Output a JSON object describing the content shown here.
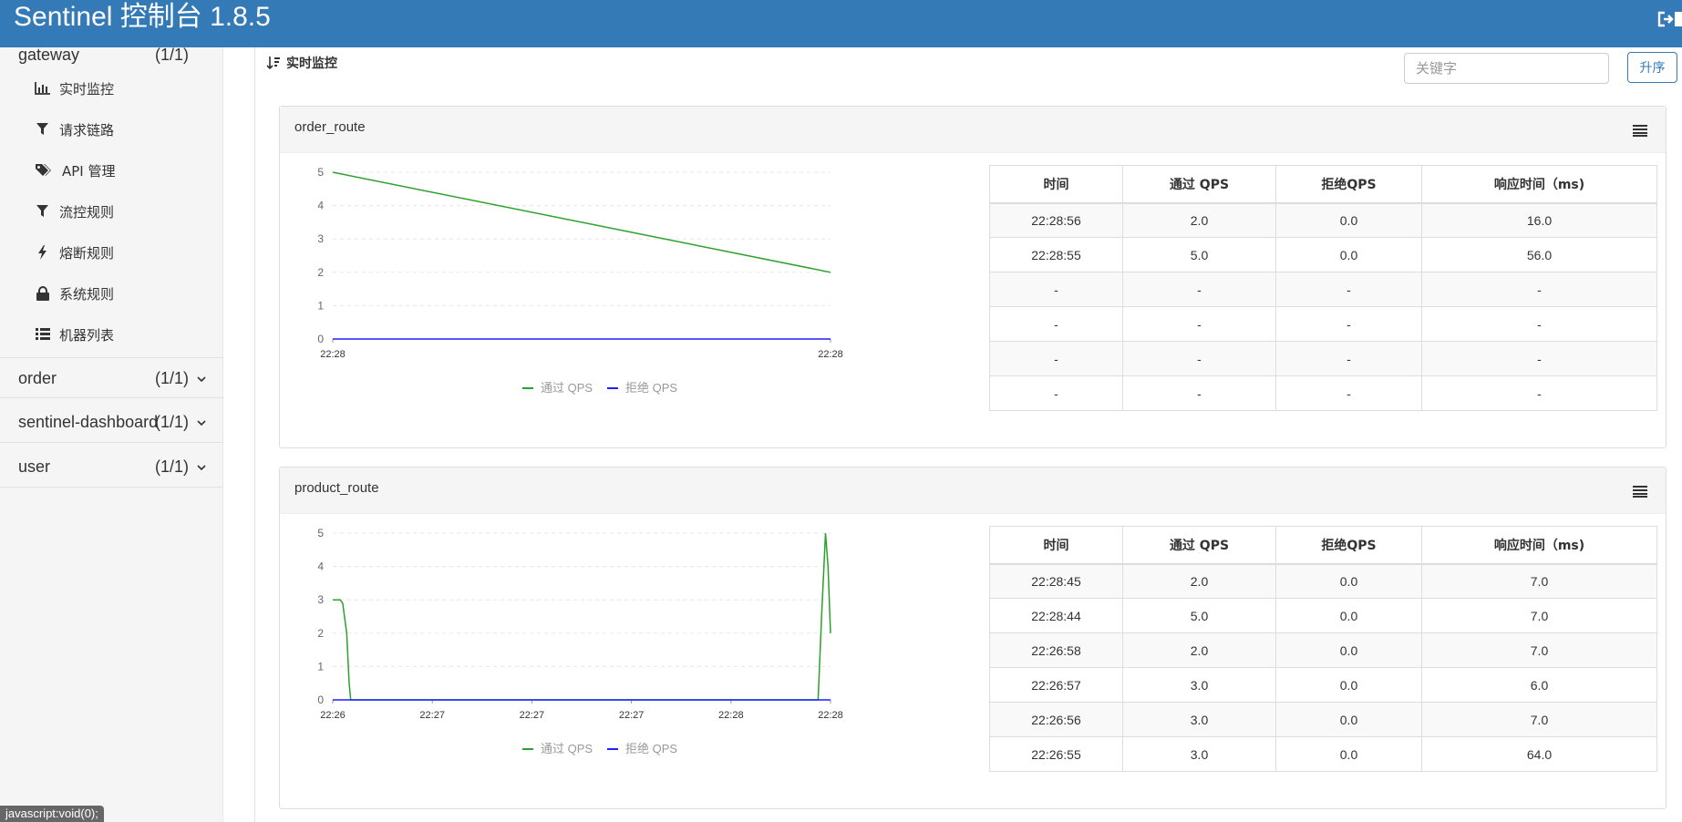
{
  "header": {
    "title": "Sentinel 控制台 1.8.5"
  },
  "sidebar": {
    "apps": [
      {
        "name": "gateway",
        "count": "(1/1)",
        "expanded": true
      },
      {
        "name": "order",
        "count": "(1/1)",
        "expanded": false
      },
      {
        "name": "sentinel-dashboard",
        "count": "(1/1)",
        "expanded": false
      },
      {
        "name": "user",
        "count": "(1/1)",
        "expanded": false
      }
    ],
    "menu": [
      {
        "label": "实时监控",
        "icon": "bar-chart-icon"
      },
      {
        "label": "请求链路",
        "icon": "filter-icon"
      },
      {
        "label": "API 管理",
        "icon": "tags-icon"
      },
      {
        "label": "流控规则",
        "icon": "filter-icon"
      },
      {
        "label": "熔断规则",
        "icon": "flash-icon"
      },
      {
        "label": "系统规则",
        "icon": "lock-icon"
      },
      {
        "label": "机器列表",
        "icon": "list-icon"
      }
    ]
  },
  "status_bar": "javascript:void(0);",
  "main": {
    "breadcrumb": "实时监控",
    "search_placeholder": "关键字",
    "sort_label": "升序",
    "table_headers": [
      "时间",
      "通过 QPS",
      "拒绝QPS",
      "响应时间（ms)"
    ],
    "legend": {
      "pass": "通过 QPS",
      "block": "拒绝 QPS"
    },
    "colors": {
      "pass": "#2ca02c",
      "block": "#1f1fff",
      "accent": "#337ab7"
    }
  },
  "resources": [
    {
      "name": "order_route",
      "rows": [
        [
          "22:28:56",
          "2.0",
          "0.0",
          "16.0"
        ],
        [
          "22:28:55",
          "5.0",
          "0.0",
          "56.0"
        ],
        [
          "-",
          "-",
          "-",
          "-"
        ],
        [
          "-",
          "-",
          "-",
          "-"
        ],
        [
          "-",
          "-",
          "-",
          "-"
        ],
        [
          "-",
          "-",
          "-",
          "-"
        ]
      ],
      "chart_data": {
        "type": "line",
        "x_ticks": [
          "22:28",
          "22:28"
        ],
        "y_ticks": [
          "0",
          "1",
          "2",
          "3",
          "4",
          "5"
        ],
        "ylim": [
          0,
          5
        ],
        "xlim": [
          0,
          1
        ],
        "grid": true,
        "legend_position": "bottom",
        "series": [
          {
            "name": "通过 QPS",
            "points": [
              [
                0,
                5
              ],
              [
                1,
                2
              ]
            ]
          },
          {
            "name": "拒绝 QPS",
            "points": [
              [
                0,
                0
              ],
              [
                1,
                0
              ]
            ]
          }
        ]
      }
    },
    {
      "name": "product_route",
      "rows": [
        [
          "22:28:45",
          "2.0",
          "0.0",
          "7.0"
        ],
        [
          "22:28:44",
          "5.0",
          "0.0",
          "7.0"
        ],
        [
          "22:26:58",
          "2.0",
          "0.0",
          "7.0"
        ],
        [
          "22:26:57",
          "3.0",
          "0.0",
          "6.0"
        ],
        [
          "22:26:56",
          "3.0",
          "0.0",
          "7.0"
        ],
        [
          "22:26:55",
          "3.0",
          "0.0",
          "64.0"
        ]
      ],
      "chart_data": {
        "type": "line",
        "x_ticks": [
          "22:26",
          "22:27",
          "22:27",
          "22:27",
          "22:28",
          "22:28"
        ],
        "y_ticks": [
          "0",
          "1",
          "2",
          "3",
          "4",
          "5"
        ],
        "ylim": [
          0,
          5
        ],
        "xlim": [
          0,
          1
        ],
        "grid": true,
        "legend_position": "bottom",
        "series": [
          {
            "name": "通过 QPS",
            "points": [
              [
                0,
                3
              ],
              [
                0.015,
                3
              ],
              [
                0.02,
                2.9
              ],
              [
                0.028,
                2
              ],
              [
                0.033,
                0.5
              ],
              [
                0.036,
                0
              ],
              [
                0.975,
                0
              ],
              [
                0.982,
                2.5
              ],
              [
                0.99,
                5
              ],
              [
                0.995,
                4
              ],
              [
                1,
                2
              ]
            ]
          },
          {
            "name": "拒绝 QPS",
            "points": [
              [
                0,
                0
              ],
              [
                1,
                0
              ]
            ]
          }
        ]
      }
    }
  ]
}
